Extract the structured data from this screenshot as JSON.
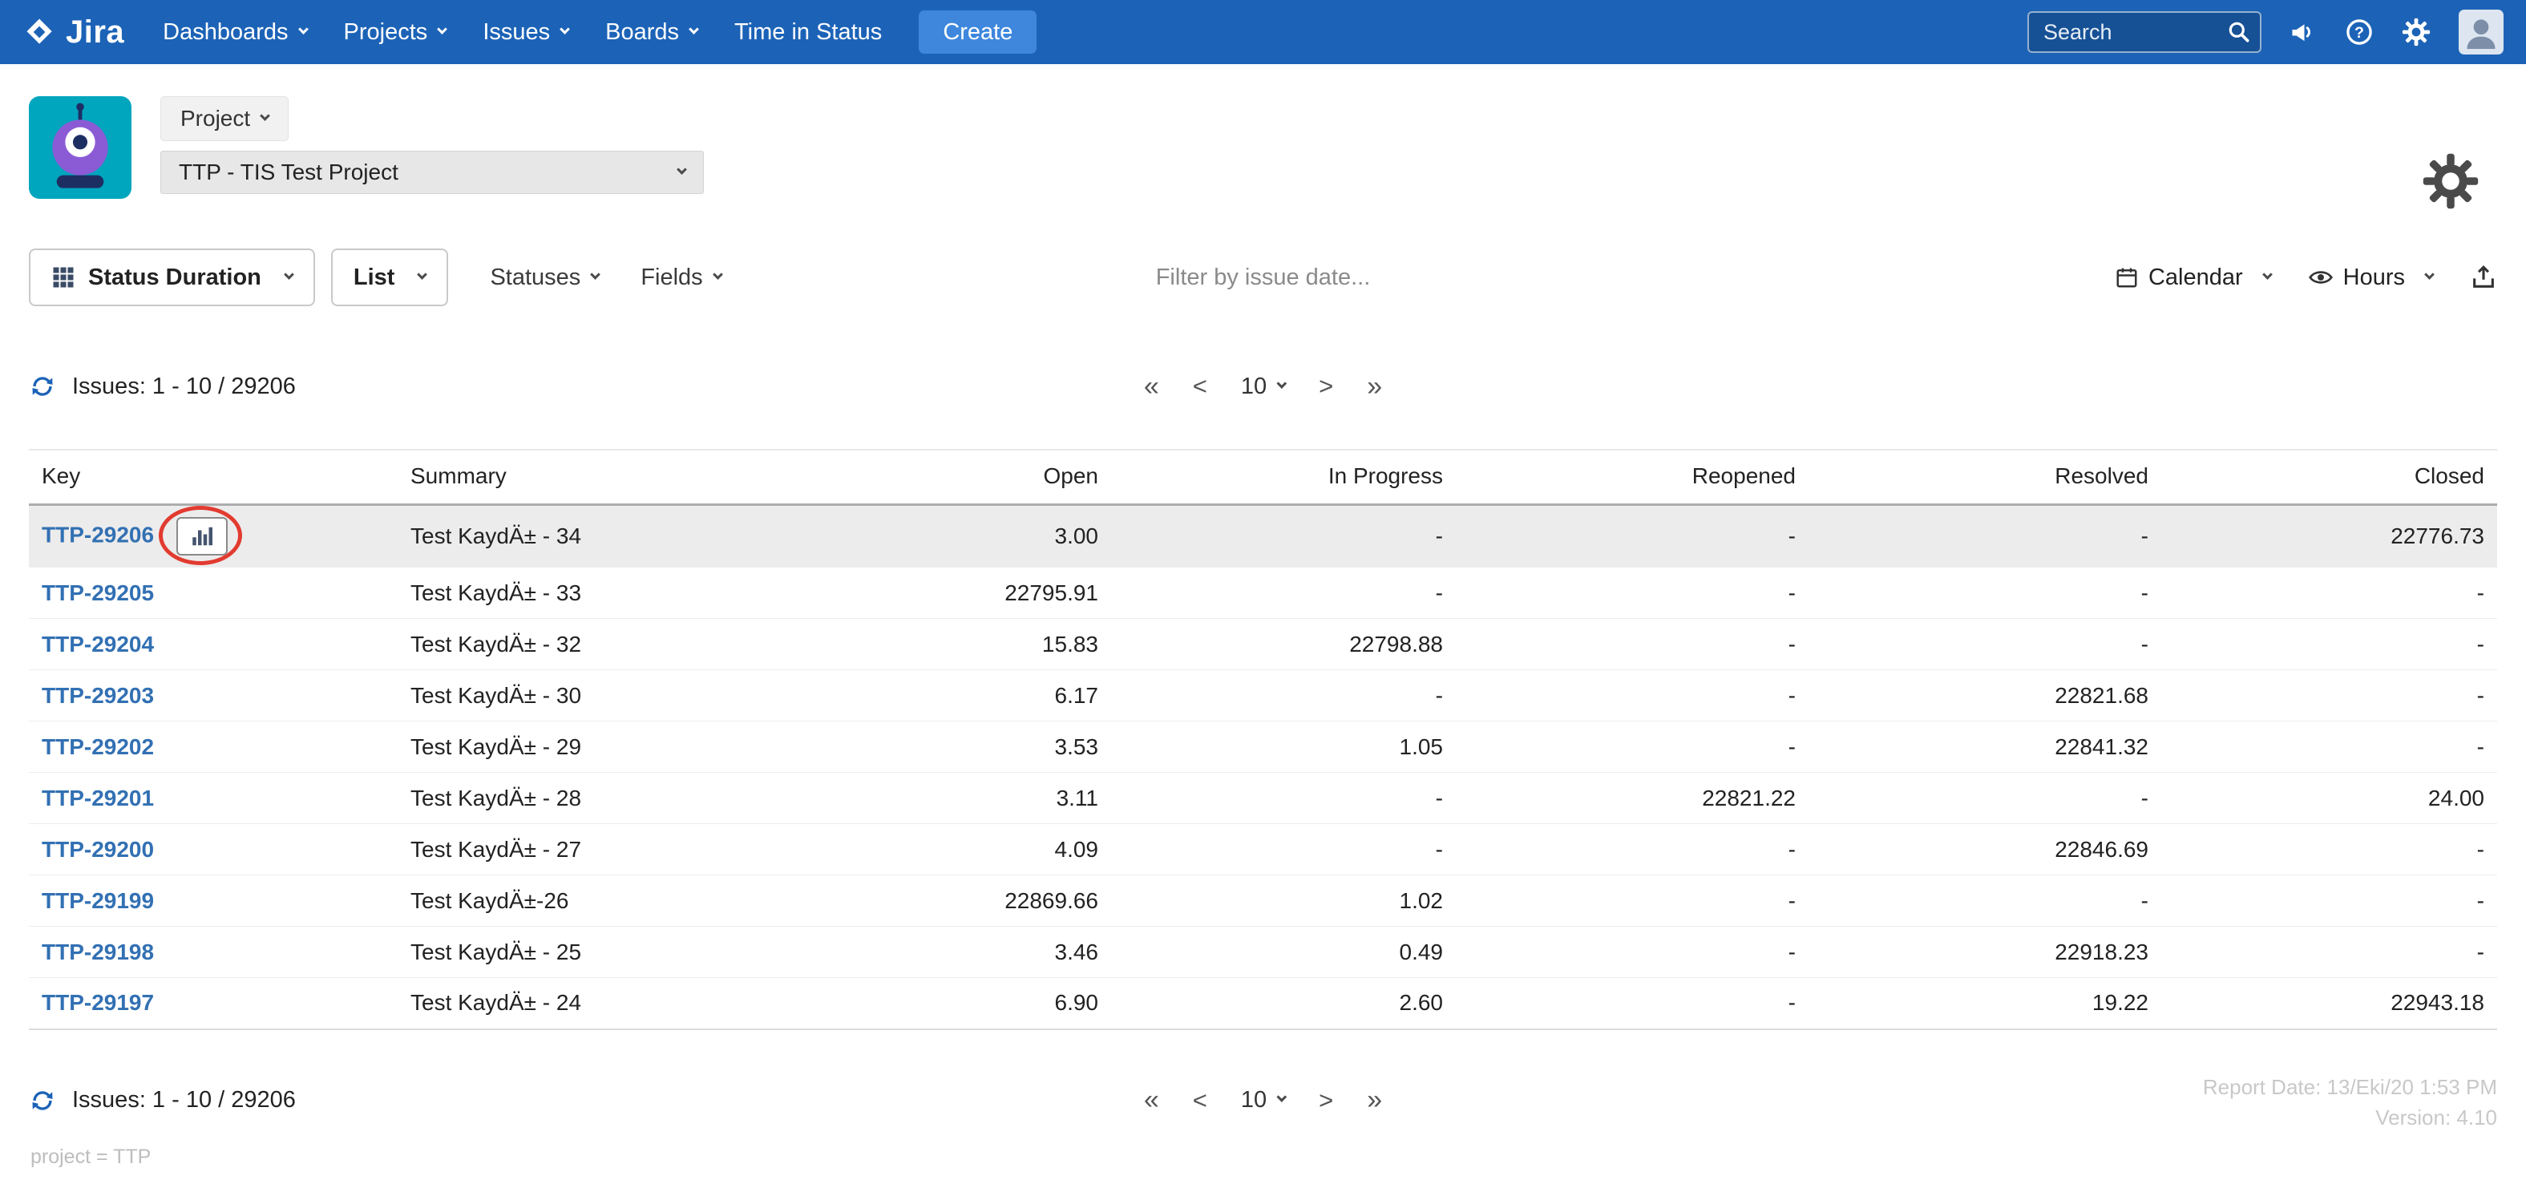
{
  "nav": {
    "brand": "Jira",
    "items": [
      {
        "label": "Dashboards",
        "caret": true
      },
      {
        "label": "Projects",
        "caret": true
      },
      {
        "label": "Issues",
        "caret": true
      },
      {
        "label": "Boards",
        "caret": true
      },
      {
        "label": "Time in Status",
        "caret": false
      }
    ],
    "create_label": "Create",
    "search_placeholder": "Search"
  },
  "header": {
    "project_chip": "Project",
    "project_select": "TTP - TIS Test Project"
  },
  "toolbar": {
    "report_type": "Status Duration",
    "view": "List",
    "statuses": "Statuses",
    "fields": "Fields",
    "filter_placeholder": "Filter by issue date...",
    "calendar": "Calendar",
    "hours": "Hours"
  },
  "pagination": {
    "issues_label": "Issues: 1 - 10 / 29206",
    "first": "«",
    "prev": "<",
    "page_size": "10",
    "next": ">",
    "last": "»"
  },
  "table": {
    "columns": [
      "Key",
      "Summary",
      "Open",
      "In Progress",
      "Reopened",
      "Resolved",
      "Closed"
    ],
    "rows": [
      {
        "key": "TTP-29206",
        "summary": "Test KaydÄ± - 34",
        "open": "3.00",
        "in_progress": "-",
        "reopened": "-",
        "resolved": "-",
        "closed": "22776.73",
        "highlighted": true,
        "chart_button": true
      },
      {
        "key": "TTP-29205",
        "summary": "Test KaydÄ± - 33",
        "open": "22795.91",
        "in_progress": "-",
        "reopened": "-",
        "resolved": "-",
        "closed": "-"
      },
      {
        "key": "TTP-29204",
        "summary": "Test KaydÄ± - 32",
        "open": "15.83",
        "in_progress": "22798.88",
        "reopened": "-",
        "resolved": "-",
        "closed": "-"
      },
      {
        "key": "TTP-29203",
        "summary": "Test KaydÄ± - 30",
        "open": "6.17",
        "in_progress": "-",
        "reopened": "-",
        "resolved": "22821.68",
        "closed": "-"
      },
      {
        "key": "TTP-29202",
        "summary": "Test KaydÄ± - 29",
        "open": "3.53",
        "in_progress": "1.05",
        "reopened": "-",
        "resolved": "22841.32",
        "closed": "-"
      },
      {
        "key": "TTP-29201",
        "summary": "Test KaydÄ± - 28",
        "open": "3.11",
        "in_progress": "-",
        "reopened": "22821.22",
        "resolved": "-",
        "closed": "24.00"
      },
      {
        "key": "TTP-29200",
        "summary": "Test KaydÄ± - 27",
        "open": "4.09",
        "in_progress": "-",
        "reopened": "-",
        "resolved": "22846.69",
        "closed": "-"
      },
      {
        "key": "TTP-29199",
        "summary": "Test KaydÄ±-26",
        "open": "22869.66",
        "in_progress": "1.02",
        "reopened": "-",
        "resolved": "-",
        "closed": "-"
      },
      {
        "key": "TTP-29198",
        "summary": "Test KaydÄ± - 25",
        "open": "3.46",
        "in_progress": "0.49",
        "reopened": "-",
        "resolved": "22918.23",
        "closed": "-"
      },
      {
        "key": "TTP-29197",
        "summary": "Test KaydÄ± - 24",
        "open": "6.90",
        "in_progress": "2.60",
        "reopened": "-",
        "resolved": "19.22",
        "closed": "22943.18"
      }
    ]
  },
  "footer": {
    "report_date": "Report Date: 13/Eki/20 1:53 PM",
    "version": "Version: 4.10",
    "query": "project = TTP"
  }
}
